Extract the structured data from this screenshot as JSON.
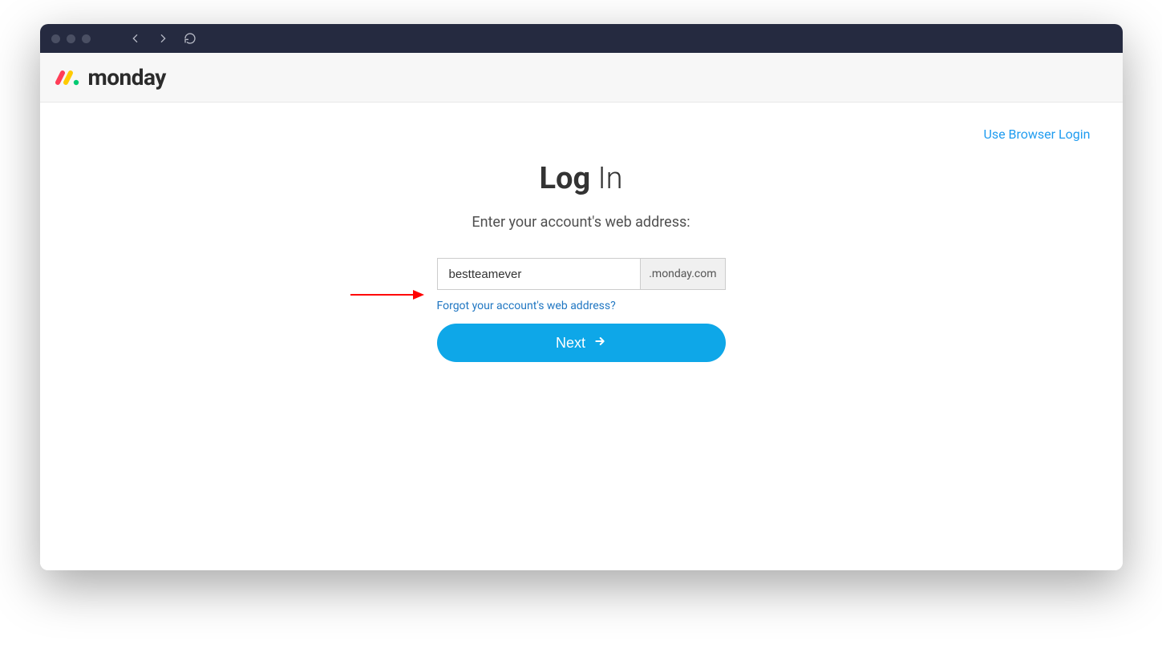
{
  "header": {
    "brand": "monday"
  },
  "topbar": {
    "browser_login_label": "Use Browser Login"
  },
  "login": {
    "title_bold": "Log",
    "title_light": "In",
    "subtitle": "Enter your account's web address:",
    "subdomain_value": "bestteamever",
    "domain_suffix": ".monday.com",
    "forgot_label": "Forgot your account's web address?",
    "next_label": "Next"
  }
}
